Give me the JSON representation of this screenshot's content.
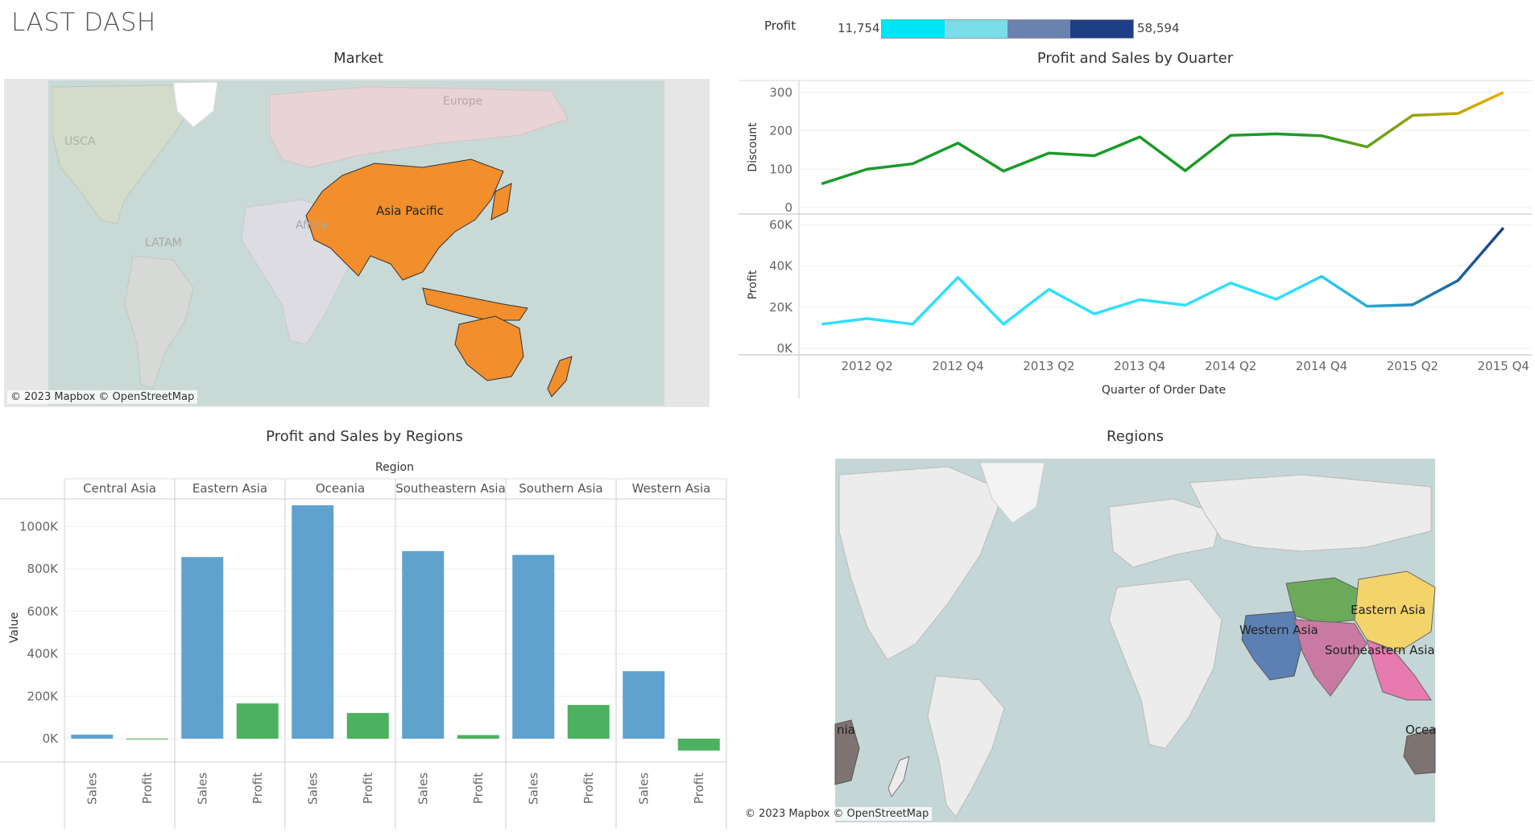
{
  "dashboard": {
    "title": "LAST DASH"
  },
  "profit_legend": {
    "label": "Profit",
    "min": "11,754",
    "max": "58,594",
    "colors": [
      "#00e5f5",
      "#7bdcea",
      "#6a82b0",
      "#1e3e86"
    ]
  },
  "market_map": {
    "title": "Market",
    "region_label": "Asia Pacific",
    "faded_labels": [
      "Europe",
      "USCA",
      "Africa",
      "LATAM"
    ],
    "highlight_color": "#f28e2b",
    "credit": "© 2023 Mapbox © OpenStreetMap"
  },
  "quarter_chart": {
    "title": "Profit and Sales by Ouarter",
    "chart_data": {
      "type": "line",
      "x": [
        "2012 Q1",
        "2012 Q2",
        "2012 Q3",
        "2012 Q4",
        "2013 Q1",
        "2013 Q2",
        "2013 Q3",
        "2013 Q4",
        "2014 Q1",
        "2014 Q2",
        "2014 Q3",
        "2014 Q4",
        "2015 Q1",
        "2015 Q2",
        "2015 Q3",
        "2015 Q4"
      ],
      "x_tick_labels": [
        "2012 Q2",
        "2012 Q4",
        "2013 Q2",
        "2013 Q4",
        "2014 Q2",
        "2014 Q4",
        "2015 Q2",
        "2015 Q4"
      ],
      "xlabel": "Quarter of Order Date",
      "panes": [
        {
          "ylabel": "Discount",
          "ylim": [
            0,
            310
          ],
          "yticks": [
            "0",
            "100",
            "200",
            "300"
          ],
          "ytick_values": [
            0,
            100,
            200,
            300
          ],
          "values": [
            62,
            100,
            114,
            168,
            95,
            142,
            135,
            184,
            96,
            188,
            192,
            187,
            158,
            240,
            245,
            300
          ],
          "color_start": "#1a9a2a",
          "color_end": "#f2a900"
        },
        {
          "ylabel": "Profit",
          "ylim": [
            0,
            61000
          ],
          "yticks": [
            "0K",
            "20K",
            "40K",
            "60K"
          ],
          "ytick_values": [
            0,
            20000,
            40000,
            60000
          ],
          "values": [
            11754,
            14500,
            11800,
            34500,
            11800,
            28700,
            16800,
            23700,
            21000,
            31800,
            23900,
            35000,
            20500,
            21200,
            33000,
            58594
          ],
          "color_start": "#2ee0ff",
          "color_end": "#1e3e86"
        }
      ]
    }
  },
  "region_bars": {
    "title": "Profit and Sales by Regions",
    "header_title": "Region",
    "chart_data": {
      "type": "bar",
      "regions": [
        "Central Asia",
        "Eastern Asia",
        "Oceania",
        "Southeastern Asia",
        "Southern Asia",
        "Western Asia"
      ],
      "measures": [
        "Sales",
        "Profit"
      ],
      "series": [
        {
          "name": "Sales",
          "values": [
            19000,
            856000,
            1100000,
            884000,
            866000,
            318000
          ],
          "color": "#5fa2ce"
        },
        {
          "name": "Profit",
          "values": [
            -3000,
            166000,
            121000,
            17000,
            159000,
            -56000
          ],
          "color": "#4cb160"
        }
      ],
      "ylabel": "Value",
      "ylim": [
        -110000,
        1130000
      ],
      "yticks": [
        "0K",
        "200K",
        "400K",
        "600K",
        "800K",
        "1000K"
      ],
      "ytick_values": [
        0,
        200000,
        400000,
        600000,
        800000,
        1000000
      ]
    }
  },
  "regions_map": {
    "title": "Regions",
    "labels": {
      "eastern": "Eastern Asia",
      "western": "Western Asia",
      "southeastern": "Southeastern Asia",
      "oceania_left": "nia",
      "oceania_right": "Ocea"
    },
    "credit": "© 2023 Mapbox © OpenStreetMap"
  }
}
